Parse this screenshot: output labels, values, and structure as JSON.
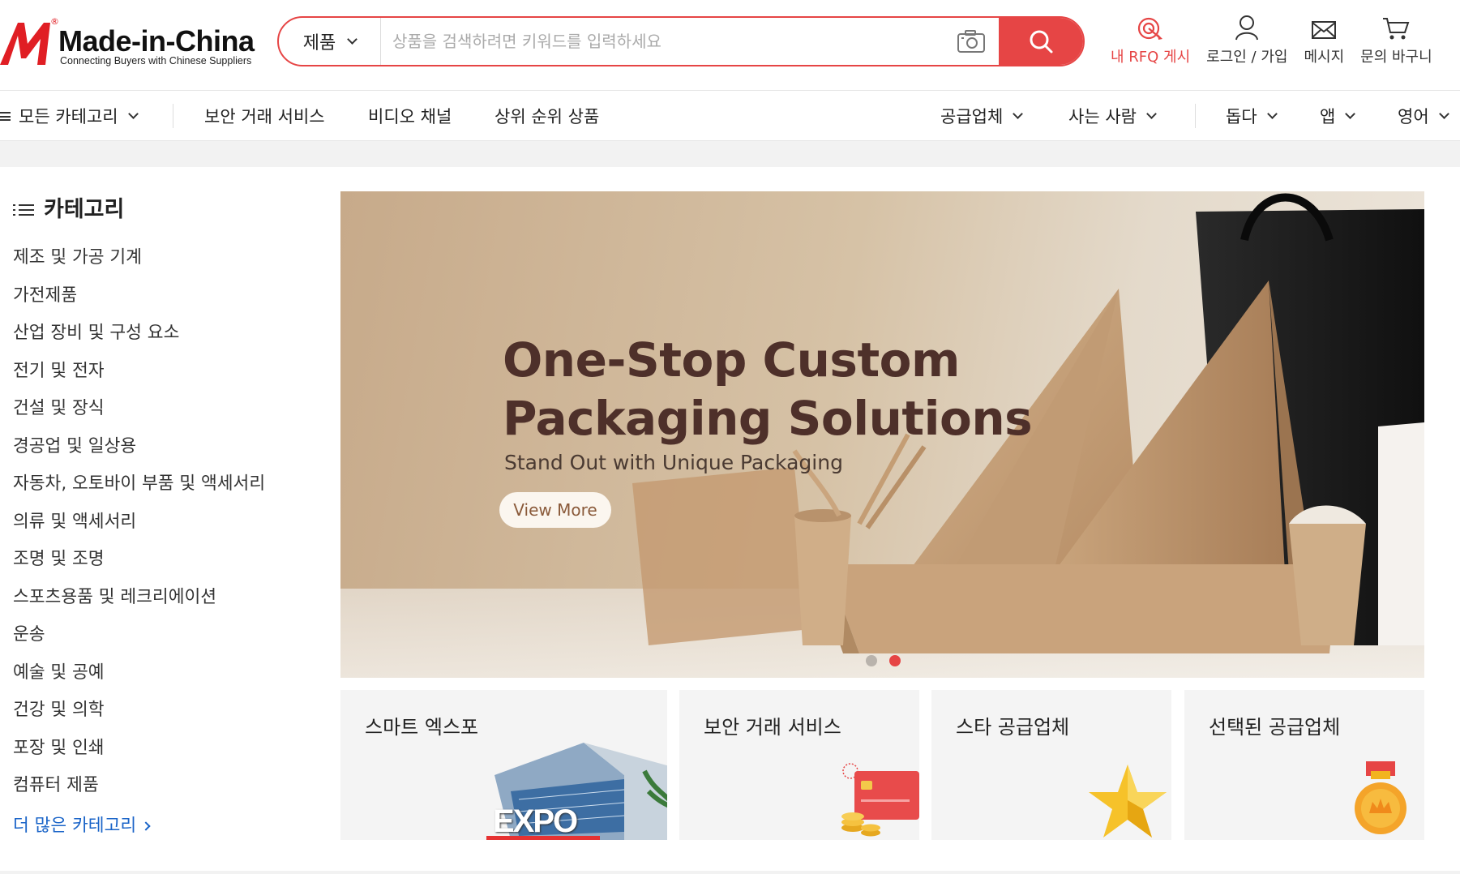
{
  "brand": {
    "name": "Made-in-China",
    "tagline": "Connecting Buyers with Chinese Suppliers",
    "accent_color": "#e64545"
  },
  "search": {
    "category": "제품",
    "placeholder": "상품을 검색하려면 키워드를 입력하세요",
    "value": ""
  },
  "header_actions": [
    {
      "label": "내 RFQ 게시",
      "icon": "rfq-target-icon"
    },
    {
      "label": "로그인 / 가입",
      "icon": "user-icon"
    },
    {
      "label": "메시지",
      "icon": "envelope-icon"
    },
    {
      "label": "문의 바구니",
      "icon": "cart-icon"
    }
  ],
  "nav": {
    "all_categories": "모든 카테고리",
    "secure_trade": "보안 거래 서비스",
    "video_channel": "비디오 채널",
    "top_products": "상위 순위 상품",
    "suppliers": "공급업체",
    "buyers": "사는 사람",
    "help": "돕다",
    "app": "앱",
    "language": "영어"
  },
  "sidebar": {
    "title": "카테고리",
    "items": [
      "제조 및 가공 기계",
      "가전제품",
      "산업 장비 및 구성 요소",
      "전기 및 전자",
      "건설 및 장식",
      "경공업 및 일상용",
      "자동차, 오토바이 부품 및 액세서리",
      "의류 및 액세서리",
      "조명 및 조명",
      "스포츠용품 및 레크리에이션",
      "운송",
      "예술 및 공예",
      "건강 및 의학",
      "포장 및 인쇄",
      "컴퓨터 제품"
    ],
    "more": "더 많은 카테고리"
  },
  "banner": {
    "title_line1": "One-Stop Custom",
    "title_line2": "Packaging Solutions",
    "subtitle": "Stand Out with Unique Packaging",
    "button": "View More",
    "slides": 2,
    "active_slide": 2
  },
  "tiles": [
    {
      "label": "스마트 엑스포",
      "image_text": "EXPO"
    },
    {
      "label": "보안 거래 서비스"
    },
    {
      "label": "스타 공급업체"
    },
    {
      "label": "선택된 공급업체"
    }
  ]
}
